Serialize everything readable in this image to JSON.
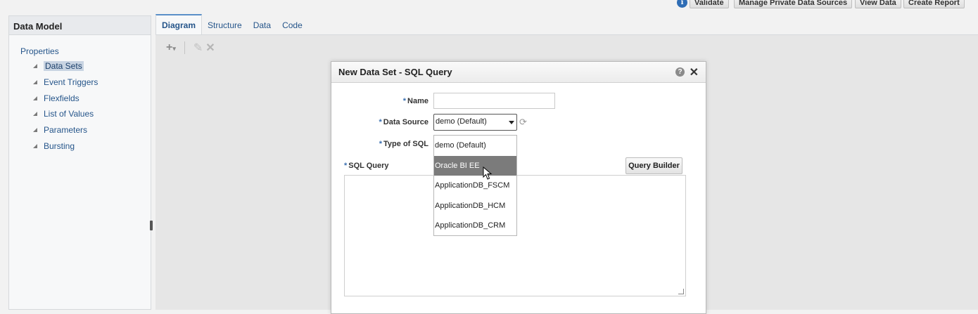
{
  "topbar": {
    "info_icon": "info-icon",
    "validate": "Validate",
    "manage_private": "Manage Private Data Sources",
    "view_data": "View Data",
    "create_report": "Create Report"
  },
  "left_panel": {
    "title": "Data Model",
    "root": "Properties",
    "items": [
      "Data Sets",
      "Event Triggers",
      "Flexfields",
      "List of Values",
      "Parameters",
      "Bursting"
    ],
    "selected": "Data Sets"
  },
  "tabs": [
    "Diagram",
    "Structure",
    "Data",
    "Code"
  ],
  "active_tab": "Diagram",
  "toolbar_icons": [
    "add-icon",
    "edit-icon",
    "delete-icon"
  ],
  "dialog": {
    "title": "New Data Set - SQL Query",
    "name_label": "Name",
    "name_value": "",
    "data_source_label": "Data Source",
    "data_source_value": "demo (Default)",
    "type_of_sql_label": "Type of SQL",
    "sql_query_label": "SQL Query",
    "query_builder": "Query Builder",
    "required_mark": "*",
    "dropdown_options": [
      "demo (Default)",
      "Oracle BI EE",
      "ApplicationDB_FSCM",
      "ApplicationDB_HCM",
      "ApplicationDB_CRM"
    ],
    "highlighted_option": "Oracle BI EE"
  },
  "colors": {
    "link": "#25558a",
    "accent": "#5a8fc8",
    "highlight": "#7b7b7b"
  }
}
